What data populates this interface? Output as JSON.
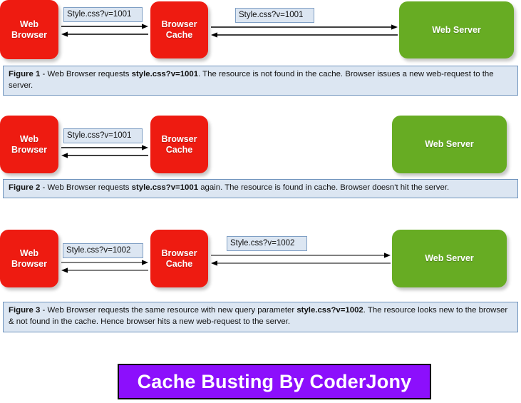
{
  "colors": {
    "browser_node": "#ee1b11",
    "cache_node": "#ee1b11",
    "server_node": "#67ac23",
    "chip_fill": "#dce6f2",
    "chip_border": "#7f9fc4",
    "caption_fill": "#dce6f2",
    "caption_border": "#6f93bd",
    "banner_fill": "#8c0ffc",
    "banner_text": "#ffffff"
  },
  "nodes": {
    "web_browser": "Web Browser",
    "browser_cache": "Browser\nCache",
    "web_server": "Web Server"
  },
  "rows": [
    {
      "id": "figure-1",
      "left_chip": "Style.css?v=1001",
      "right_chip": "Style.css?v=1001",
      "has_right_arrows": true,
      "has_server": true
    },
    {
      "id": "figure-2",
      "left_chip": "Style.css?v=1001",
      "right_chip": "",
      "has_right_arrows": false,
      "has_server": true
    },
    {
      "id": "figure-3",
      "left_chip": "Style.css?v=1002",
      "right_chip": "Style.css?v=1002",
      "has_right_arrows": true,
      "has_server": true
    }
  ],
  "captions": {
    "figure1": {
      "label": "Figure 1",
      "dash": " - ",
      "text_before": "Web Browser requests ",
      "bold": "style.css?v=1001",
      "text_after": ". The resource is not found in the cache. Browser issues a new web-request to the server."
    },
    "figure2": {
      "label": "Figure 2",
      "dash": " - ",
      "text_before": "Web Browser requests ",
      "bold": "style.css?v=1001",
      "text_after": " again. The resource is found in cache. Browser doesn't hit the server."
    },
    "figure3": {
      "label": "Figure 3",
      "dash": " - ",
      "text_before": "Web Browser requests the same resource with new query parameter ",
      "bold": "style.css?v=1002",
      "text_after": ". The resource looks new to the browser & not found in the cache. Hence browser hits a new web-request to the server."
    }
  },
  "banner": {
    "title": "Cache Busting By CoderJony"
  }
}
